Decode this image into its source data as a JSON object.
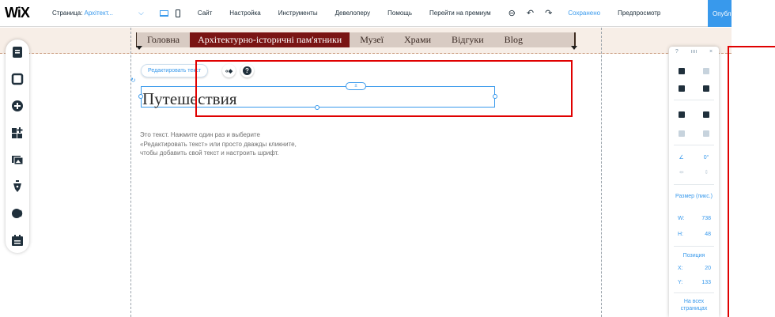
{
  "topbar": {
    "logo": "WiX",
    "page_label": "Страница:",
    "page_value": "Архітект...",
    "menu": [
      "Сайт",
      "Настройка",
      "Инструменты",
      "Девелоперу",
      "Помощь",
      "Перейти на премиум"
    ],
    "saved": "Сохранено",
    "preview": "Предпросмотр",
    "publish": "Опубл"
  },
  "site_nav": {
    "items": [
      "Головна",
      "Архітектурно-історичні пам'ятники",
      "Музеї",
      "Храми",
      "Відгуки",
      "Blog"
    ],
    "active_index": 1
  },
  "edit_toolbar": {
    "edit_text": "Редактировать текст",
    "anim_label": "«◆"
  },
  "heading": "Путешествия",
  "paragraph": "Это текст. Нажмите один раз и выберите «Редактировать текст» или просто дважды кликните, чтобы добавить свой текст и настроить шрифт.",
  "right_panel": {
    "top": [
      "?",
      "ıııı",
      "×"
    ],
    "rotation": "0°",
    "size_label": "Размер (пикс.)",
    "w_label": "W:",
    "w_value": "738",
    "h_label": "H:",
    "h_value": "48",
    "position_label": "Позиция",
    "x_label": "X:",
    "x_value": "20",
    "y_label": "Y:",
    "y_value": "133",
    "all_pages": "На всех страницах"
  },
  "colors": {
    "accent": "#3899ec",
    "nav_active": "#7a1514",
    "nav_bg": "#d8cbc3",
    "highlight": "#e00000"
  }
}
